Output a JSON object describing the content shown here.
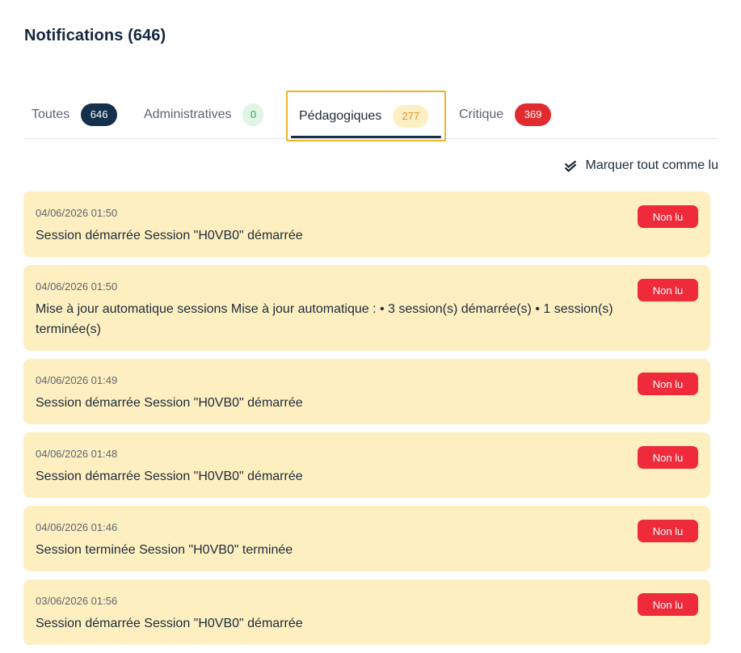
{
  "header": {
    "title": "Notifications (646)"
  },
  "tabs": [
    {
      "label": "Toutes",
      "count": "646"
    },
    {
      "label": "Administratives",
      "count": "0"
    },
    {
      "label": "Pédagogiques",
      "count": "277"
    },
    {
      "label": "Critique",
      "count": "369"
    }
  ],
  "active_tab": "Pédagogiques",
  "actions": {
    "mark_all_label": "Marquer tout comme lu"
  },
  "notifications": [
    {
      "date": "04/06/2026 01:50",
      "message": "Session démarrée Session \"H0VB0\" démarrée",
      "status": "Non lu"
    },
    {
      "date": "04/06/2026 01:50",
      "message": "Mise à jour automatique sessions Mise à jour automatique : • 3 session(s) démarrée(s) • 1 session(s) terminée(s)",
      "status": "Non lu"
    },
    {
      "date": "04/06/2026 01:49",
      "message": "Session démarrée Session \"H0VB0\" démarrée",
      "status": "Non lu"
    },
    {
      "date": "04/06/2026 01:48",
      "message": "Session démarrée Session \"H0VB0\" démarrée",
      "status": "Non lu"
    },
    {
      "date": "04/06/2026 01:46",
      "message": "Session terminée Session \"H0VB0\" terminée",
      "status": "Non lu"
    },
    {
      "date": "03/06/2026 01:56",
      "message": "Session démarrée Session \"H0VB0\" démarrée",
      "status": "Non lu"
    }
  ],
  "colors": {
    "title": "#13283f",
    "card_background": "#fdefc0",
    "unread_badge": "#ef2b3b",
    "active_tab_border": "#f0b429",
    "badge_all": "#14304d",
    "badge_admin": "#dff6e7",
    "badge_peda": "#fdefc4",
    "badge_critical": "#e12b2f"
  },
  "icons": {
    "mark_all": "double-check-icon"
  }
}
